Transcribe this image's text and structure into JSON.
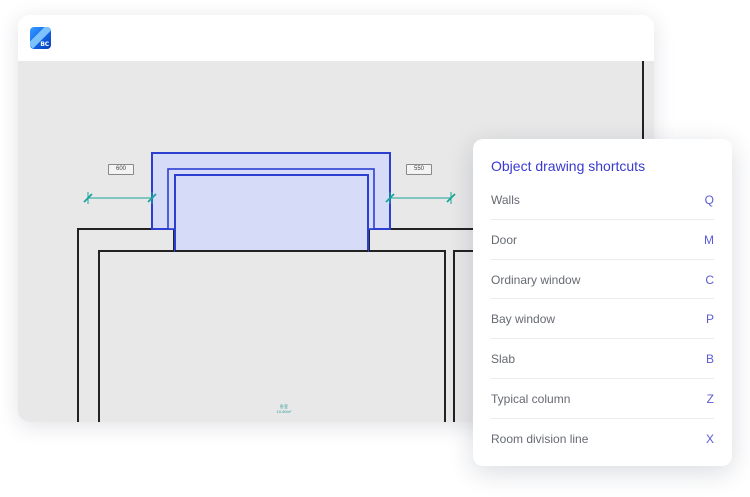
{
  "app": {
    "logo_text": "BC"
  },
  "canvas": {
    "dimension_left": "600",
    "dimension_right": "550",
    "room_name": "卧室",
    "room_area": "10.60m²"
  },
  "shortcuts": {
    "title": "Object drawing shortcuts",
    "items": [
      {
        "label": "Walls",
        "key": "Q"
      },
      {
        "label": "Door",
        "key": "M"
      },
      {
        "label": "Ordinary window",
        "key": "C"
      },
      {
        "label": "Bay window",
        "key": "P"
      },
      {
        "label": "Slab",
        "key": "B"
      },
      {
        "label": "Typical column",
        "key": "Z"
      },
      {
        "label": "Room division line",
        "key": "X"
      }
    ]
  },
  "colors": {
    "accent": "#3a3ad0",
    "bay_window_stroke": "#2c3fd0",
    "bay_window_fill": "#d6dcf7",
    "dimension_teal": "#1aa59a",
    "wall": "#222222",
    "canvas_bg": "#e8e8e8"
  }
}
